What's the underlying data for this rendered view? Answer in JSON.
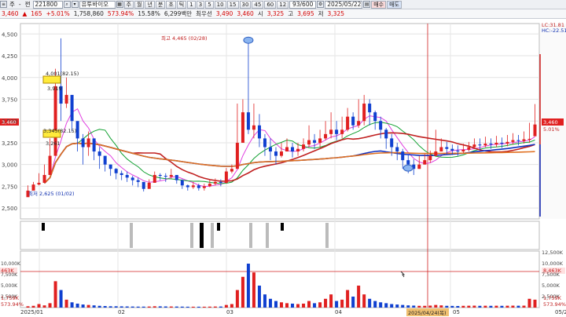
{
  "toolbar": {
    "code_prefix": "주",
    "code_label": "-",
    "code_field": "쩐",
    "stock_code": "221800",
    "stock_name": "유투바이오",
    "period_buttons": [
      "주",
      "월",
      "년",
      "분",
      "초",
      "틱",
      "1",
      "3",
      "5",
      "10",
      "15",
      "30",
      "45",
      "60",
      "12"
    ],
    "count": "93/600",
    "date": "2025/05/22",
    "buy": "매수",
    "sell": "매도"
  },
  "quote": {
    "price": "3,460",
    "change": "165",
    "change_pct": "+5.01%",
    "volume": "1,758,860",
    "vol_ratio": "573.94%",
    "turnover": "15.58%",
    "amount": "6,299백만",
    "preferred": "최우선",
    "best": "3,490",
    "p2": "3,460",
    "open_label": "시",
    "open": "3,325",
    "high_label": "고",
    "high": "3,695",
    "low_label": "저",
    "low": "3,325"
  },
  "chart_data": {
    "type": "candlestick",
    "y_ticks": [
      "4,500",
      "4,250",
      "4,000",
      "3,750",
      "3,500",
      "3,250",
      "3,000",
      "2,750",
      "2,500"
    ],
    "ylim": [
      2375,
      4620
    ],
    "vol_ticks": [
      "12,500K",
      "10,000K",
      "7,500K",
      "5,000K",
      "2,500K"
    ],
    "vol_ticks_left": [
      "10,000K",
      "7,500K",
      "5,000K",
      "2,500K"
    ],
    "x_labels": [
      "2025/01",
      "02",
      "03",
      "04",
      "05",
      "05/22"
    ],
    "hover_label": "2025/04/24(목)",
    "right_labels": {
      "lc": "LC:31.81",
      "hc": "HC:-22.51",
      "price": "3,460",
      "pct": "5.01%",
      "vol": "8,463K",
      "vol2": "1,759K",
      "vol3": "573.94%"
    },
    "left_labels": {
      "price": "3,460",
      "vol": "463K",
      "vol2": "1,759K",
      "vol3": "573.94%"
    },
    "high_annot": "최고 4,465 (02/28)",
    "low_annot": "최저 2,625 (01/02)",
    "box_annots": [
      "4,001(82.15)",
      "3,919",
      "3,345(82.15)",
      "3,261"
    ],
    "candles": [
      [
        2700,
        2760,
        2650,
        2625
      ],
      [
        2770,
        2800,
        2720,
        2700
      ],
      [
        2790,
        2900,
        2760,
        2770
      ],
      [
        2880,
        3000,
        2850,
        2790
      ],
      [
        3100,
        3300,
        2900,
        2880
      ],
      [
        3900,
        4100,
        3800,
        3100
      ],
      [
        3700,
        4450,
        3500,
        3900
      ],
      [
        3800,
        4000,
        3650,
        3700
      ],
      [
        3500,
        3780,
        3380,
        3800
      ],
      [
        3300,
        3450,
        3150,
        3500
      ],
      [
        3200,
        3350,
        3000,
        3300
      ],
      [
        3300,
        3380,
        3100,
        3200
      ],
      [
        3150,
        3300,
        3050,
        3300
      ],
      [
        3100,
        3200,
        2950,
        3150
      ],
      [
        3000,
        3080,
        2920,
        3100
      ],
      [
        2950,
        3000,
        2870,
        3000
      ],
      [
        2900,
        2960,
        2830,
        2950
      ],
      [
        2880,
        2930,
        2820,
        2900
      ],
      [
        2850,
        2920,
        2800,
        2880
      ],
      [
        2820,
        2870,
        2760,
        2850
      ],
      [
        2800,
        2850,
        2740,
        2820
      ],
      [
        2720,
        2790,
        2690,
        2800
      ],
      [
        2790,
        2830,
        2740,
        2720
      ],
      [
        2880,
        2920,
        2790,
        2790
      ],
      [
        2870,
        2900,
        2820,
        2880
      ],
      [
        2860,
        2900,
        2800,
        2870
      ],
      [
        2880,
        2950,
        2840,
        2860
      ],
      [
        2820,
        2880,
        2780,
        2880
      ],
      [
        2760,
        2830,
        2720,
        2820
      ],
      [
        2740,
        2770,
        2700,
        2760
      ],
      [
        2760,
        2800,
        2720,
        2740
      ],
      [
        2730,
        2780,
        2700,
        2760
      ],
      [
        2750,
        2780,
        2700,
        2730
      ],
      [
        2780,
        2820,
        2740,
        2750
      ],
      [
        2800,
        2840,
        2760,
        2780
      ],
      [
        2790,
        2830,
        2750,
        2800
      ],
      [
        2920,
        2960,
        2780,
        2790
      ],
      [
        2950,
        3000,
        2900,
        2920
      ],
      [
        3250,
        3700,
        2950,
        2950
      ],
      [
        3600,
        3750,
        3300,
        3250
      ],
      [
        3400,
        4465,
        3350,
        3600
      ],
      [
        3450,
        3700,
        3300,
        3400
      ],
      [
        3300,
        3580,
        3200,
        3450
      ],
      [
        3200,
        3350,
        3100,
        3300
      ],
      [
        3150,
        3300,
        3050,
        3200
      ],
      [
        3100,
        3200,
        3000,
        3150
      ],
      [
        3150,
        3250,
        3080,
        3100
      ],
      [
        3200,
        3300,
        3150,
        3150
      ],
      [
        3150,
        3250,
        3080,
        3200
      ],
      [
        3180,
        3250,
        3100,
        3150
      ],
      [
        3230,
        3300,
        3150,
        3180
      ],
      [
        3280,
        3450,
        3200,
        3230
      ],
      [
        3250,
        3350,
        3180,
        3280
      ],
      [
        3300,
        3400,
        3200,
        3250
      ],
      [
        3350,
        3500,
        3280,
        3300
      ],
      [
        3400,
        3600,
        3300,
        3350
      ],
      [
        3350,
        3500,
        3280,
        3400
      ],
      [
        3400,
        3550,
        3300,
        3350
      ],
      [
        3550,
        3650,
        3380,
        3400
      ],
      [
        3450,
        3600,
        3400,
        3550
      ],
      [
        3500,
        3750,
        3420,
        3450
      ],
      [
        3700,
        3800,
        3450,
        3500
      ],
      [
        3600,
        3750,
        3450,
        3700
      ],
      [
        3500,
        3620,
        3400,
        3600
      ],
      [
        3400,
        3550,
        3300,
        3500
      ],
      [
        3300,
        3420,
        3180,
        3400
      ],
      [
        3200,
        3350,
        3100,
        3300
      ],
      [
        3150,
        3250,
        3050,
        3200
      ],
      [
        3050,
        3180,
        2950,
        3150
      ],
      [
        3000,
        3120,
        2900,
        3050
      ],
      [
        2950,
        3060,
        2880,
        3000
      ],
      [
        3000,
        3100,
        2950,
        2950
      ],
      [
        3050,
        3120,
        3000,
        3000
      ],
      [
        3100,
        3160,
        3020,
        3050
      ],
      [
        3150,
        3400,
        3100,
        3100
      ],
      [
        3200,
        3300,
        3150,
        3150
      ],
      [
        3180,
        3260,
        3120,
        3200
      ],
      [
        3160,
        3230,
        3110,
        3180
      ],
      [
        3150,
        3220,
        3100,
        3160
      ],
      [
        3170,
        3240,
        3130,
        3150
      ],
      [
        3200,
        3260,
        3150,
        3170
      ],
      [
        3230,
        3300,
        3180,
        3200
      ],
      [
        3220,
        3300,
        3170,
        3230
      ],
      [
        3240,
        3320,
        3200,
        3220
      ],
      [
        3230,
        3300,
        3180,
        3240
      ],
      [
        3250,
        3330,
        3200,
        3230
      ],
      [
        3240,
        3310,
        3190,
        3250
      ],
      [
        3260,
        3340,
        3210,
        3240
      ],
      [
        3280,
        3360,
        3230,
        3260
      ],
      [
        3270,
        3340,
        3220,
        3280
      ],
      [
        3290,
        3380,
        3240,
        3270
      ],
      [
        3295,
        3480,
        3250,
        3290
      ],
      [
        3460,
        3695,
        3325,
        3325
      ]
    ],
    "volumes": [
      30,
      40,
      80,
      50,
      100,
      600,
      400,
      180,
      120,
      90,
      70,
      60,
      50,
      40,
      35,
      30,
      30,
      28,
      26,
      24,
      22,
      22,
      24,
      30,
      28,
      26,
      25,
      24,
      22,
      20,
      20,
      20,
      20,
      22,
      24,
      24,
      60,
      80,
      400,
      700,
      1000,
      800,
      500,
      300,
      200,
      150,
      120,
      100,
      90,
      80,
      90,
      150,
      100,
      120,
      200,
      300,
      150,
      180,
      400,
      250,
      500,
      300,
      200,
      150,
      120,
      100,
      80,
      70,
      60,
      50,
      45,
      40,
      40,
      45,
      60,
      50,
      40,
      38,
      36,
      40,
      42,
      44,
      40,
      42,
      40,
      42,
      40,
      42,
      44,
      42,
      44,
      200,
      180
    ]
  }
}
